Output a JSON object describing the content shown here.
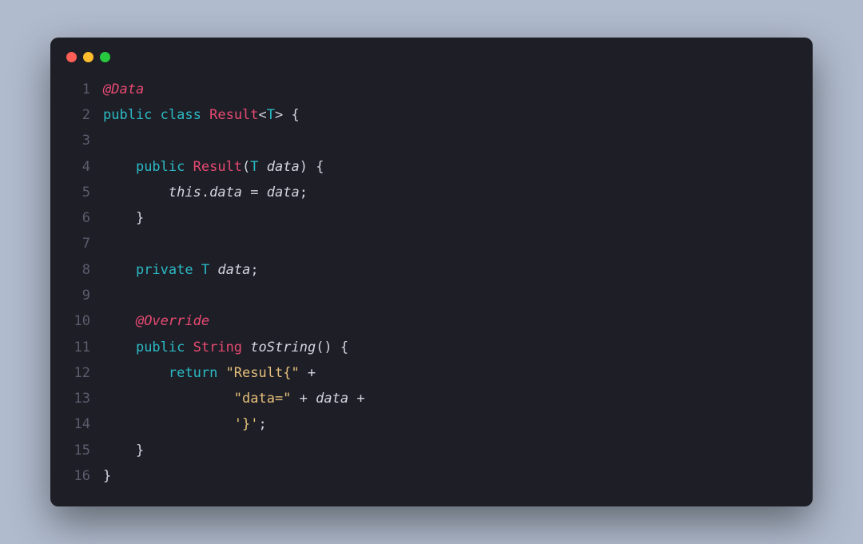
{
  "window": {
    "traffic_lights": [
      "red",
      "yellow",
      "green"
    ]
  },
  "code": {
    "lines": [
      {
        "num": "1",
        "tokens": [
          {
            "cls": "t-annotation",
            "text": "@Data"
          }
        ]
      },
      {
        "num": "2",
        "tokens": [
          {
            "cls": "t-keyword",
            "text": "public"
          },
          {
            "cls": "t-plain",
            "text": " "
          },
          {
            "cls": "t-keyword",
            "text": "class"
          },
          {
            "cls": "t-plain",
            "text": " "
          },
          {
            "cls": "t-class",
            "text": "Result"
          },
          {
            "cls": "t-punc",
            "text": "<"
          },
          {
            "cls": "t-generic",
            "text": "T"
          },
          {
            "cls": "t-punc",
            "text": "> {"
          }
        ]
      },
      {
        "num": "3",
        "tokens": []
      },
      {
        "num": "4",
        "tokens": [
          {
            "cls": "t-plain",
            "text": "    "
          },
          {
            "cls": "t-keyword",
            "text": "public"
          },
          {
            "cls": "t-plain",
            "text": " "
          },
          {
            "cls": "t-class",
            "text": "Result"
          },
          {
            "cls": "t-punc",
            "text": "("
          },
          {
            "cls": "t-generic",
            "text": "T"
          },
          {
            "cls": "t-plain",
            "text": " "
          },
          {
            "cls": "t-param",
            "text": "data"
          },
          {
            "cls": "t-punc",
            "text": ") {"
          }
        ]
      },
      {
        "num": "5",
        "tokens": [
          {
            "cls": "t-plain",
            "text": "        "
          },
          {
            "cls": "t-this",
            "text": "this"
          },
          {
            "cls": "t-punc",
            "text": "."
          },
          {
            "cls": "t-field",
            "text": "data"
          },
          {
            "cls": "t-plain",
            "text": " = "
          },
          {
            "cls": "t-param",
            "text": "data"
          },
          {
            "cls": "t-punc",
            "text": ";"
          }
        ]
      },
      {
        "num": "6",
        "tokens": [
          {
            "cls": "t-plain",
            "text": "    "
          },
          {
            "cls": "t-punc",
            "text": "}"
          }
        ]
      },
      {
        "num": "7",
        "tokens": []
      },
      {
        "num": "8",
        "tokens": [
          {
            "cls": "t-plain",
            "text": "    "
          },
          {
            "cls": "t-keyword",
            "text": "private"
          },
          {
            "cls": "t-plain",
            "text": " "
          },
          {
            "cls": "t-generic",
            "text": "T"
          },
          {
            "cls": "t-plain",
            "text": " "
          },
          {
            "cls": "t-field",
            "text": "data"
          },
          {
            "cls": "t-punc",
            "text": ";"
          }
        ]
      },
      {
        "num": "9",
        "tokens": []
      },
      {
        "num": "10",
        "tokens": [
          {
            "cls": "t-plain",
            "text": "    "
          },
          {
            "cls": "t-annotation",
            "text": "@Override"
          }
        ]
      },
      {
        "num": "11",
        "tokens": [
          {
            "cls": "t-plain",
            "text": "    "
          },
          {
            "cls": "t-keyword",
            "text": "public"
          },
          {
            "cls": "t-plain",
            "text": " "
          },
          {
            "cls": "t-type",
            "text": "String"
          },
          {
            "cls": "t-plain",
            "text": " "
          },
          {
            "cls": "t-method",
            "text": "toString"
          },
          {
            "cls": "t-punc",
            "text": "() {"
          }
        ]
      },
      {
        "num": "12",
        "tokens": [
          {
            "cls": "t-plain",
            "text": "        "
          },
          {
            "cls": "t-keyword",
            "text": "return"
          },
          {
            "cls": "t-plain",
            "text": " "
          },
          {
            "cls": "t-string",
            "text": "\"Result{\""
          },
          {
            "cls": "t-plain",
            "text": " + "
          }
        ]
      },
      {
        "num": "13",
        "tokens": [
          {
            "cls": "t-plain",
            "text": "                "
          },
          {
            "cls": "t-string",
            "text": "\"data=\""
          },
          {
            "cls": "t-plain",
            "text": " + "
          },
          {
            "cls": "t-field",
            "text": "data"
          },
          {
            "cls": "t-plain",
            "text": " + "
          }
        ]
      },
      {
        "num": "14",
        "tokens": [
          {
            "cls": "t-plain",
            "text": "                "
          },
          {
            "cls": "t-string",
            "text": "'}'"
          },
          {
            "cls": "t-punc",
            "text": ";"
          }
        ]
      },
      {
        "num": "15",
        "tokens": [
          {
            "cls": "t-plain",
            "text": "    "
          },
          {
            "cls": "t-punc",
            "text": "}"
          }
        ]
      },
      {
        "num": "16",
        "tokens": [
          {
            "cls": "t-punc",
            "text": "}"
          }
        ]
      }
    ]
  }
}
